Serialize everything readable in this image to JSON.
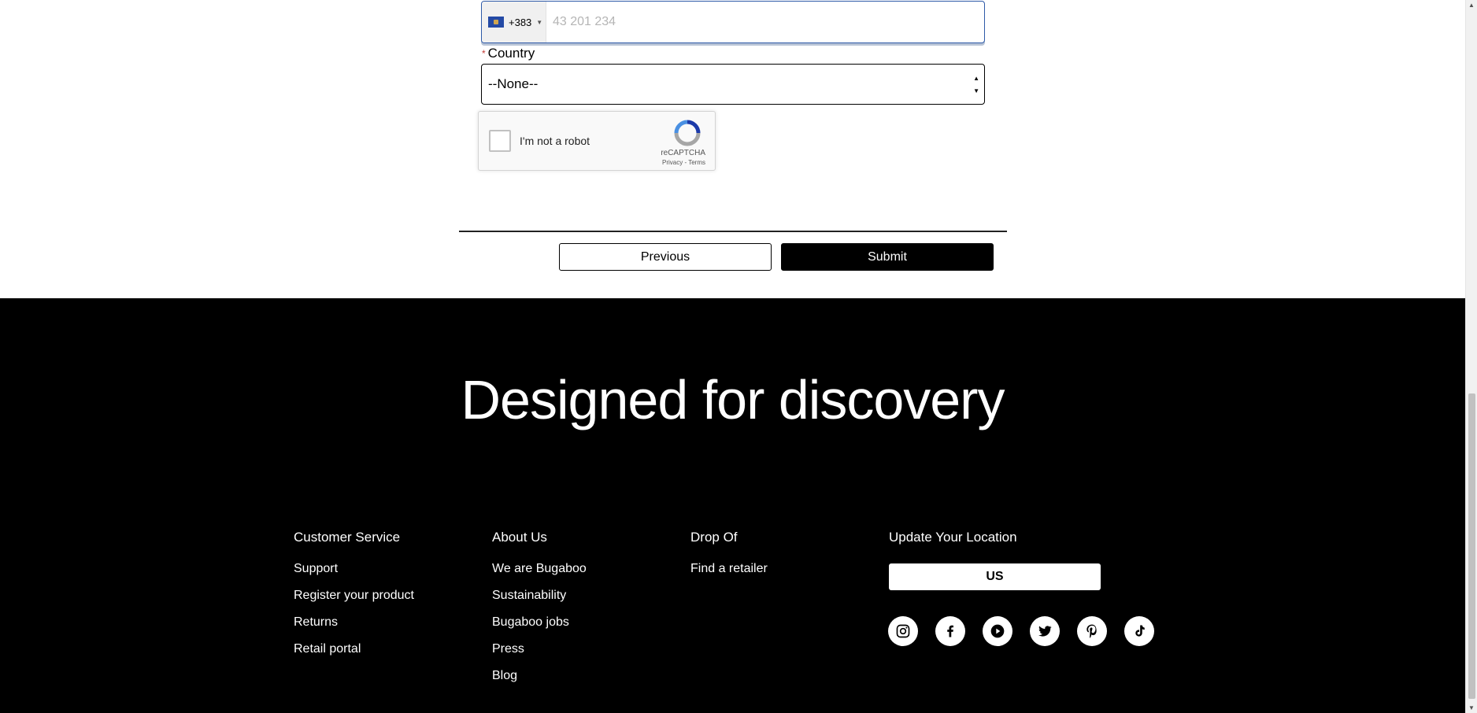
{
  "form": {
    "phone": {
      "country_code": "+383",
      "placeholder": "43 201 234",
      "value": ""
    },
    "country": {
      "label": "Country",
      "required_marker": "*",
      "selected": "--None--"
    },
    "captcha": {
      "label": "I'm not a robot",
      "brand": "reCAPTCHA",
      "links": "Privacy - Terms"
    },
    "buttons": {
      "previous": "Previous",
      "submit": "Submit"
    }
  },
  "footer": {
    "tagline": "Designed for discovery",
    "columns": [
      {
        "title": "Customer Service",
        "links": [
          "Support",
          "Register your product",
          "Returns",
          "Retail portal"
        ]
      },
      {
        "title": "About Us",
        "links": [
          "We are Bugaboo",
          "Sustainability",
          "Bugaboo jobs",
          "Press",
          "Blog"
        ]
      },
      {
        "title": "Drop Of",
        "links": [
          "Find a retailer"
        ]
      }
    ],
    "location": {
      "title": "Update Your Location",
      "button": "US"
    },
    "socials": [
      "instagram-icon",
      "facebook-icon",
      "youtube-icon",
      "twitter-icon",
      "pinterest-icon",
      "tiktok-icon"
    ]
  }
}
